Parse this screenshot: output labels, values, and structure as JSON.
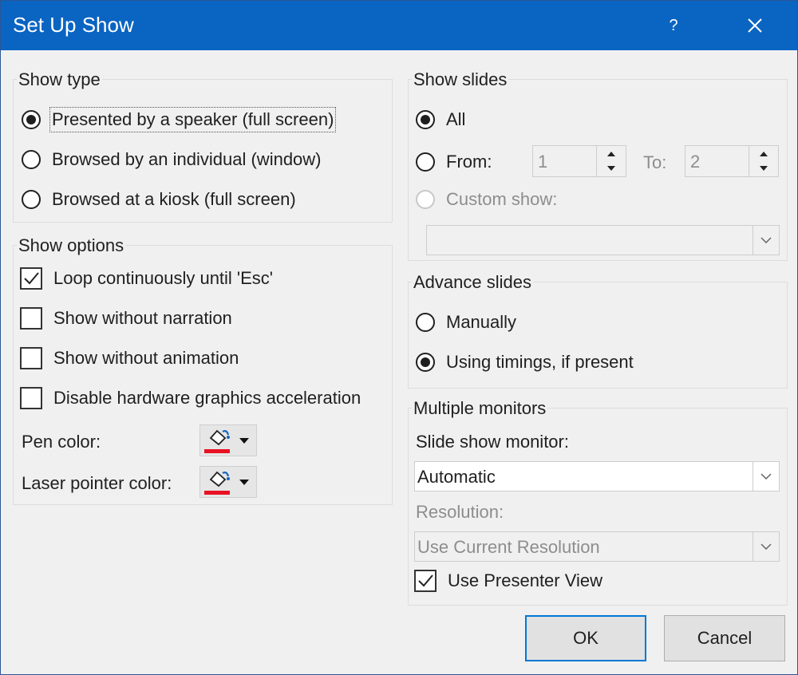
{
  "window": {
    "title": "Set Up Show",
    "help": "?"
  },
  "show_type": {
    "title": "Show type",
    "options": [
      {
        "label": "Presented by a speaker (full screen)",
        "selected": true
      },
      {
        "label": "Browsed by an individual (window)",
        "selected": false
      },
      {
        "label": "Browsed at a kiosk (full screen)",
        "selected": false
      }
    ]
  },
  "show_options": {
    "title": "Show options",
    "checks": [
      {
        "label": "Loop continuously until 'Esc'",
        "checked": true
      },
      {
        "label": "Show without narration",
        "checked": false
      },
      {
        "label": "Show without animation",
        "checked": false
      },
      {
        "label": "Disable hardware graphics acceleration",
        "checked": false
      }
    ],
    "pen_color_label": "Pen color:",
    "laser_color_label": "Laser pointer color:",
    "swatch_color": "#e81123"
  },
  "show_slides": {
    "title": "Show slides",
    "all_label": "All",
    "from_label": "From:",
    "from_value": "1",
    "to_label": "To:",
    "to_value": "2",
    "custom_label": "Custom show:",
    "custom_value": ""
  },
  "advance_slides": {
    "title": "Advance slides",
    "manually_label": "Manually",
    "timings_label": "Using timings, if present",
    "selected": "timings"
  },
  "monitors": {
    "title": "Multiple monitors",
    "monitor_label": "Slide show monitor:",
    "monitor_value": "Automatic",
    "resolution_label": "Resolution:",
    "resolution_value": "Use Current Resolution",
    "presenter_label": "Use Presenter View",
    "presenter_checked": true
  },
  "buttons": {
    "ok": "OK",
    "cancel": "Cancel"
  },
  "colors": {
    "titlebar": "#0a64c2",
    "default_button_border": "#0078d7"
  }
}
